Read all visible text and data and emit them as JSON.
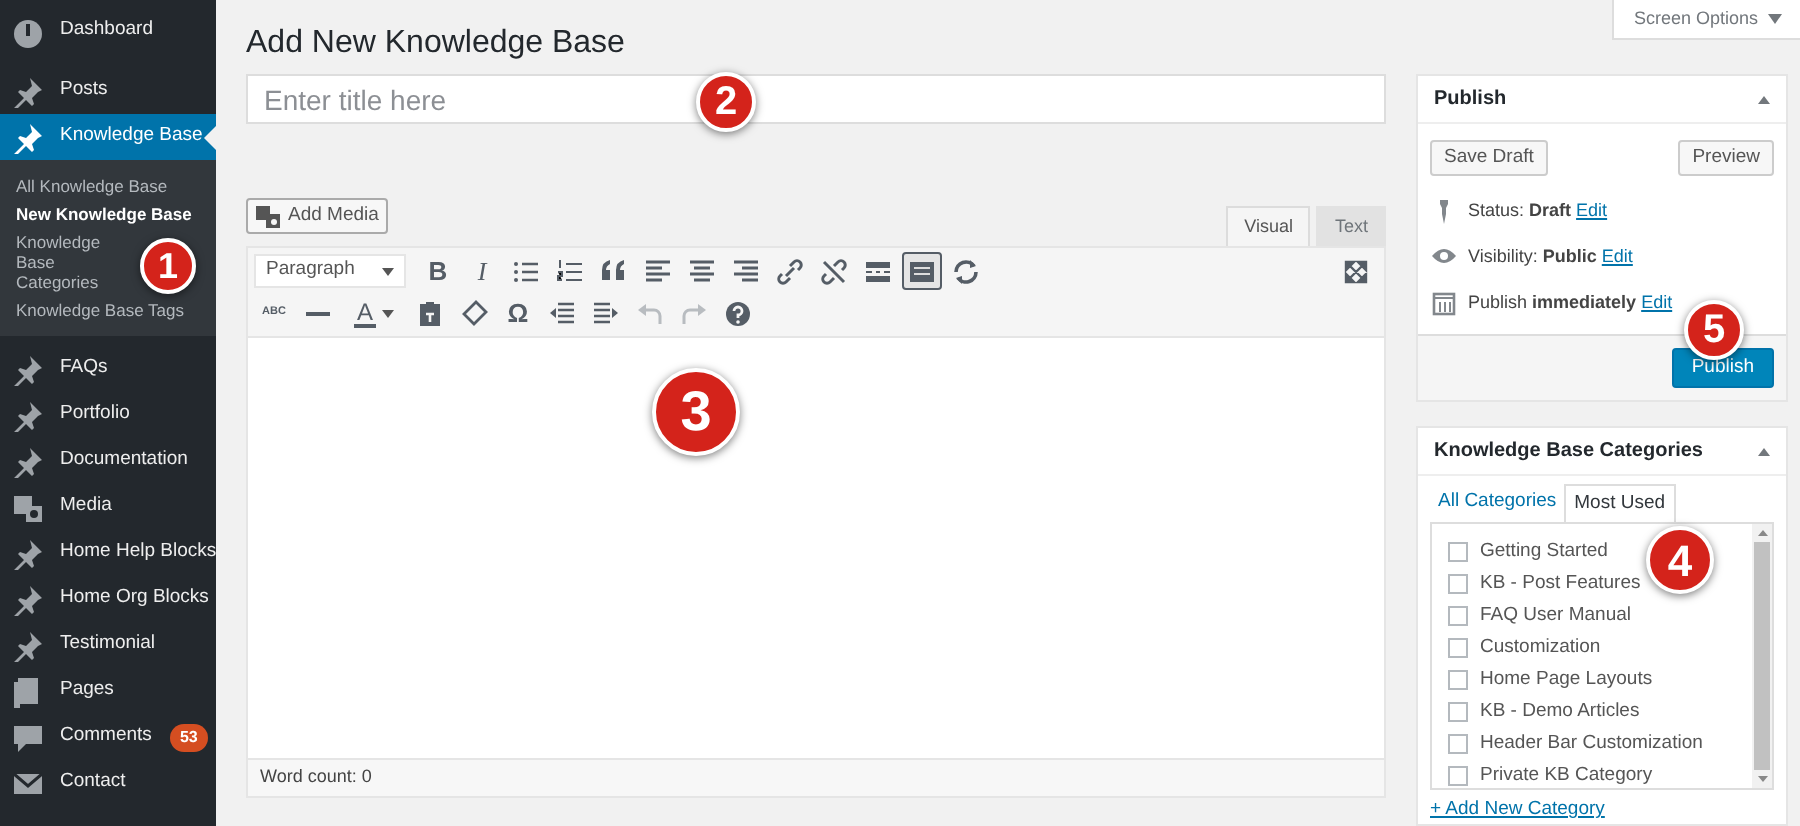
{
  "sidebar": {
    "items": [
      {
        "label": "Dashboard",
        "selected": false
      },
      {
        "label": "Posts",
        "selected": false
      },
      {
        "label": "Knowledge Base",
        "selected": true,
        "children": [
          {
            "label": "All Knowledge Base",
            "selected": false
          },
          {
            "label": "New Knowledge Base",
            "selected": true
          },
          {
            "label": "Knowledge Base Categories",
            "selected": false
          },
          {
            "label": "Knowledge Base Tags",
            "selected": false
          }
        ]
      },
      {
        "label": "FAQs",
        "selected": false
      },
      {
        "label": "Portfolio",
        "selected": false
      },
      {
        "label": "Documentation",
        "selected": false
      },
      {
        "label": "Media",
        "selected": false
      },
      {
        "label": "Home Help Blocks",
        "selected": false
      },
      {
        "label": "Home Org Blocks",
        "selected": false
      },
      {
        "label": "Testimonial",
        "selected": false
      },
      {
        "label": "Pages",
        "selected": false
      },
      {
        "label": "Comments",
        "selected": false,
        "badge": "53"
      },
      {
        "label": "Contact",
        "selected": false
      }
    ]
  },
  "screen_options": "Screen Options",
  "page_title": "Add New Knowledge Base",
  "title_field": {
    "placeholder": "Enter title here"
  },
  "add_media": "Add Media",
  "editor_tabs": [
    {
      "label": "Visual",
      "selected": true
    },
    {
      "label": "Text",
      "selected": false
    }
  ],
  "toolbar": [
    [
      {
        "kind": "select",
        "value": "Paragraph"
      },
      {
        "kind": "glyph",
        "text": "B"
      },
      {
        "kind": "glyph",
        "text": "I"
      },
      {
        "kind": "icon"
      },
      {
        "kind": "icon"
      },
      {
        "kind": "icon"
      },
      {
        "kind": "icon"
      },
      {
        "kind": "icon"
      },
      {
        "kind": "icon"
      },
      {
        "kind": "icon"
      },
      {
        "kind": "icon"
      },
      {
        "kind": "icon"
      },
      {
        "kind": "icon",
        "pressed": true
      },
      {
        "kind": "icon"
      }
    ],
    [
      {
        "kind": "glyph",
        "text": "ABC"
      },
      {
        "kind": "icon"
      },
      {
        "kind": "color",
        "text": "A"
      },
      {
        "kind": "icon"
      },
      {
        "kind": "icon"
      },
      {
        "kind": "glyph",
        "text": "Ω"
      },
      {
        "kind": "icon"
      },
      {
        "kind": "icon"
      },
      {
        "kind": "icon",
        "disabled": true
      },
      {
        "kind": "icon",
        "disabled": true
      },
      {
        "kind": "icon"
      }
    ]
  ],
  "word_count": "Word count: 0",
  "publish": {
    "title": "Publish",
    "save_draft": "Save Draft",
    "preview": "Preview",
    "rows": [
      {
        "label": "Status: ",
        "value": "Draft",
        "link": "Edit"
      },
      {
        "label": "Visibility: ",
        "value": "Public",
        "link": "Edit"
      },
      {
        "label": "Publish ",
        "value": "immediately",
        "link": "Edit"
      }
    ],
    "button": "Publish"
  },
  "categories": {
    "title": "Knowledge Base Categories",
    "tabs": [
      {
        "label": "All Categories",
        "selected": false
      },
      {
        "label": "Most Used",
        "selected": true
      }
    ],
    "items": [
      {
        "label": "Getting Started",
        "checked": false
      },
      {
        "label": "KB - Post Features",
        "checked": false
      },
      {
        "label": "FAQ User Manual",
        "checked": false
      },
      {
        "label": "Customization",
        "checked": false
      },
      {
        "label": "Home Page Layouts",
        "checked": false
      },
      {
        "label": "KB - Demo Articles",
        "checked": false
      },
      {
        "label": "Header Bar Customization",
        "checked": false
      },
      {
        "label": "Private KB Category",
        "checked": false
      }
    ],
    "add_link": "+ Add New Category"
  },
  "callouts": [
    {
      "text": "1"
    },
    {
      "text": "2"
    },
    {
      "text": "3"
    },
    {
      "text": "4"
    },
    {
      "text": "5"
    }
  ]
}
